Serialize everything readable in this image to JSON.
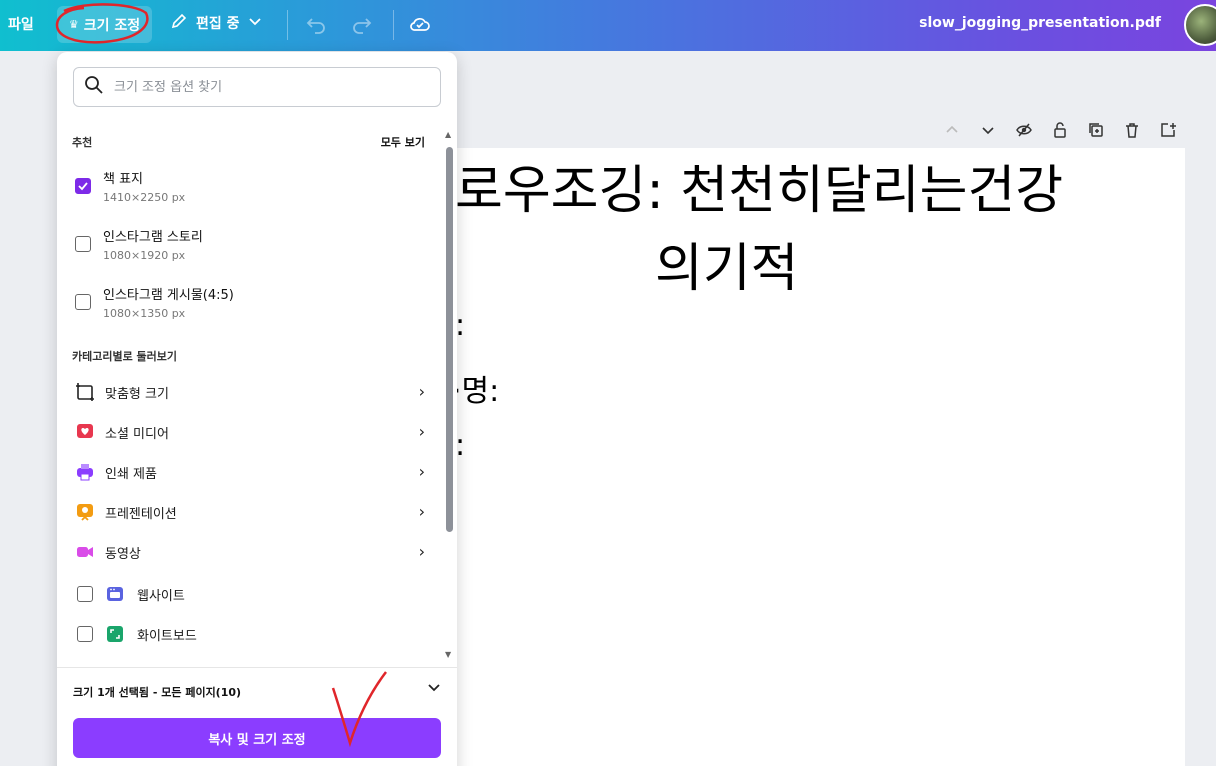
{
  "topbar": {
    "file_label": "파일",
    "resize_label": "크기 조정",
    "edit_label": "편집 중",
    "filename": "slow_jogging_presentation.pdf"
  },
  "panel": {
    "search_placeholder": "크기 조정 옵션 찾기",
    "recommended_label": "추천",
    "see_all": "모두 보기",
    "recommended": [
      {
        "name": "책 표지",
        "size": "1410×2250 px",
        "checked": true
      },
      {
        "name": "인스타그램 스토리",
        "size": "1080×1920 px",
        "checked": false
      },
      {
        "name": "인스타그램 게시물(4:5)",
        "size": "1080×1350 px",
        "checked": false
      }
    ],
    "category_label": "카테고리별로 둘러보기",
    "categories": [
      {
        "label": "맞춤형 크기",
        "icon": "custom-size-icon"
      },
      {
        "label": "소셜 미디어",
        "icon": "social-media-icon"
      },
      {
        "label": "인쇄 제품",
        "icon": "print-icon"
      },
      {
        "label": "프레젠테이션",
        "icon": "presentation-icon"
      },
      {
        "label": "동영상",
        "icon": "video-icon"
      }
    ],
    "checkbox_items": [
      {
        "label": "웹사이트",
        "icon": "website-icon"
      },
      {
        "label": "화이트보드",
        "icon": "whiteboard-icon"
      }
    ],
    "selection_text": "크기 1개 선택됨 - 모든 페이지(10)",
    "primary_button": "복사 및 크기 조정"
  },
  "page": {
    "title_line1": "로우조깅: 천천히달리는건강",
    "title_line2": "의기적",
    "line_a": ":",
    "line_b": "·명:",
    "line_c": ":"
  },
  "colors": {
    "accent": "#8b3dff",
    "checked": "#7d2ae8",
    "annotation": "#e0262b"
  }
}
